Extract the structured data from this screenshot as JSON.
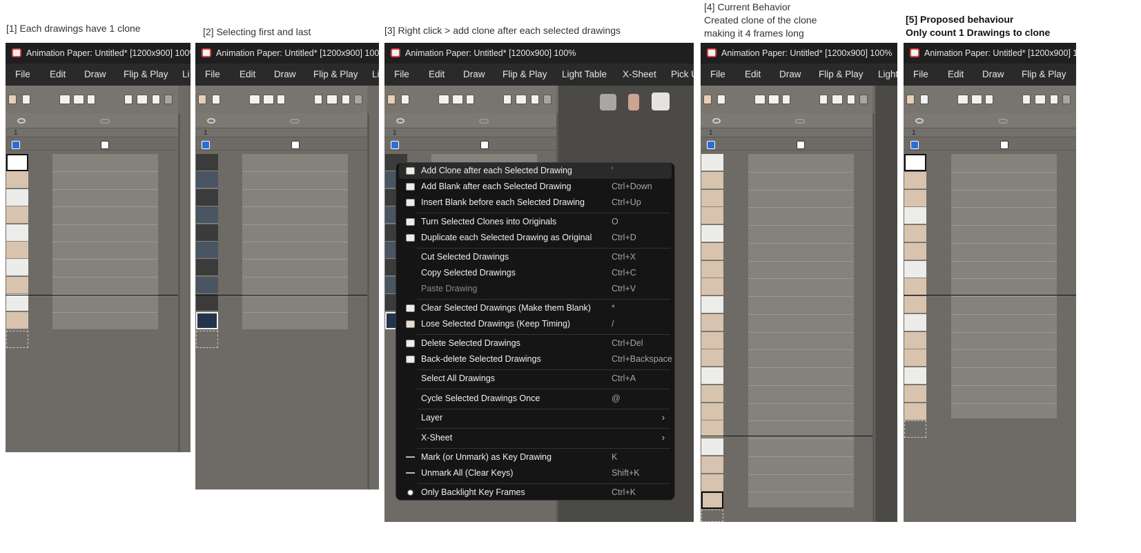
{
  "captions": {
    "c1": "[1] Each drawings have 1 clone",
    "c2": "[2] Selecting first and last",
    "c3": "[3] Right click > add clone after each selected drawings",
    "c4_l1": "[4] Current Behavior",
    "c4_l2": "Created clone of the clone",
    "c4_l3": "making it 4 frames long",
    "c5_l1": "[5] Proposed behaviour",
    "c5_l2": "Only count 1 Drawings to clone"
  },
  "window": {
    "title": "Animation Paper: Untitled* [1200x900] 100%",
    "frame_number": "1"
  },
  "menus": {
    "file": "File",
    "edit": "Edit",
    "draw": "Draw",
    "flip": "Flip & Play",
    "light": "Light Table",
    "light_short": "Light",
    "light_cut": "Li",
    "xsheet": "X-Sheet",
    "pick": "Pick U"
  },
  "context_menu": {
    "items": [
      {
        "label": "Add Clone after each Selected Drawing",
        "shortcut": "'",
        "icon": "add-clone-icon"
      },
      {
        "label": "Add Blank after each Selected Drawing",
        "shortcut": "Ctrl+Down",
        "icon": "add-blank-icon"
      },
      {
        "label": "Insert Blank before each Selected Drawing",
        "shortcut": "Ctrl+Up",
        "icon": "insert-blank-icon"
      },
      {
        "label": "Turn Selected Clones into Originals",
        "shortcut": "O",
        "icon": "clone-to-original-icon"
      },
      {
        "label": "Duplicate each Selected Drawing as Original",
        "shortcut": "Ctrl+D",
        "icon": "duplicate-icon"
      },
      {
        "label": "Cut Selected Drawings",
        "shortcut": "Ctrl+X",
        "icon": ""
      },
      {
        "label": "Copy Selected Drawings",
        "shortcut": "Ctrl+C",
        "icon": ""
      },
      {
        "label": "Paste Drawing",
        "shortcut": "Ctrl+V",
        "icon": "",
        "disabled": true
      },
      {
        "label": "Clear Selected Drawings (Make them Blank)",
        "shortcut": "*",
        "icon": "clear-icon"
      },
      {
        "label": "Lose Selected Drawings (Keep Timing)",
        "shortcut": "/",
        "icon": "lose-icon"
      },
      {
        "label": "Delete Selected Drawings",
        "shortcut": "Ctrl+Del",
        "icon": "delete-icon"
      },
      {
        "label": "Back-delete Selected Drawings",
        "shortcut": "Ctrl+Backspace",
        "icon": "back-delete-icon"
      },
      {
        "label": "Select All Drawings",
        "shortcut": "Ctrl+A",
        "icon": ""
      },
      {
        "label": "Cycle Selected Drawings Once",
        "shortcut": "@",
        "icon": ""
      },
      {
        "label": "Layer",
        "shortcut": "",
        "icon": "",
        "submenu": true
      },
      {
        "label": "X-Sheet",
        "shortcut": "",
        "icon": "",
        "submenu": true
      },
      {
        "label": "Mark (or Unmark) as Key Drawing",
        "shortcut": "K",
        "icon": "key-icon"
      },
      {
        "label": "Unmark All (Clear Keys)",
        "shortcut": "Shift+K",
        "icon": "unmark-key-icon"
      },
      {
        "label": "Only Backlight Key Frames",
        "shortcut": "Ctrl+K",
        "icon": "backlight-icon"
      }
    ],
    "submenu_arrow": "›"
  }
}
